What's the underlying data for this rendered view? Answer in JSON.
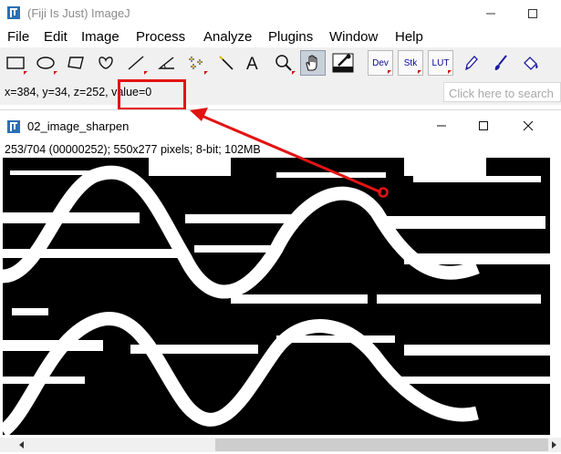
{
  "window": {
    "title": "(Fiji Is Just) ImageJ",
    "app_icon": "fiji-app-icon",
    "controls": [
      "minimize-icon",
      "maximize-icon"
    ]
  },
  "menu": {
    "items": [
      "File",
      "Edit",
      "Image",
      "Process",
      "Analyze",
      "Plugins",
      "Window",
      "Help"
    ]
  },
  "toolbar": {
    "tools": [
      {
        "icon": "rectangle-tool-icon"
      },
      {
        "icon": "oval-tool-icon"
      },
      {
        "icon": "polygon-tool-icon"
      },
      {
        "icon": "freehand-tool-icon"
      },
      {
        "icon": "straight-line-tool-icon"
      },
      {
        "icon": "angle-tool-icon"
      },
      {
        "icon": "multipoint-tool-icon"
      },
      {
        "icon": "wand-tool-icon"
      },
      {
        "icon": "text-tool-icon",
        "glyph": "A"
      },
      {
        "icon": "magnifying-glass-icon"
      },
      {
        "icon": "hand-scroll-tool-icon",
        "selected": true
      },
      {
        "icon": "color-picker-tool-icon"
      },
      {
        "icon": "dev-tools-menu",
        "label": "Dev"
      },
      {
        "icon": "stack-tools-menu",
        "label": "Stk"
      },
      {
        "icon": "lut-menu",
        "label": "LUT"
      },
      {
        "icon": "pencil-tool-icon"
      },
      {
        "icon": "paintbrush-tool-icon"
      },
      {
        "icon": "flood-fill-tool-icon"
      }
    ]
  },
  "status": {
    "text": "x=384, y=34, z=252, value=0",
    "search_placeholder": "Click here to search"
  },
  "image_window": {
    "title": "02_image_sharpen",
    "info": "253/704 (00000252); 550x277 pixels; 8-bit; 102MB",
    "controls": [
      "minimize-icon",
      "maximize-icon",
      "close-icon"
    ]
  },
  "annotation": {
    "color": "#e31313"
  },
  "colors": {
    "toolbar_bg": "#f0f0f0",
    "selected_tool_bg": "#c8d0da",
    "accent_red": "#e31313"
  }
}
